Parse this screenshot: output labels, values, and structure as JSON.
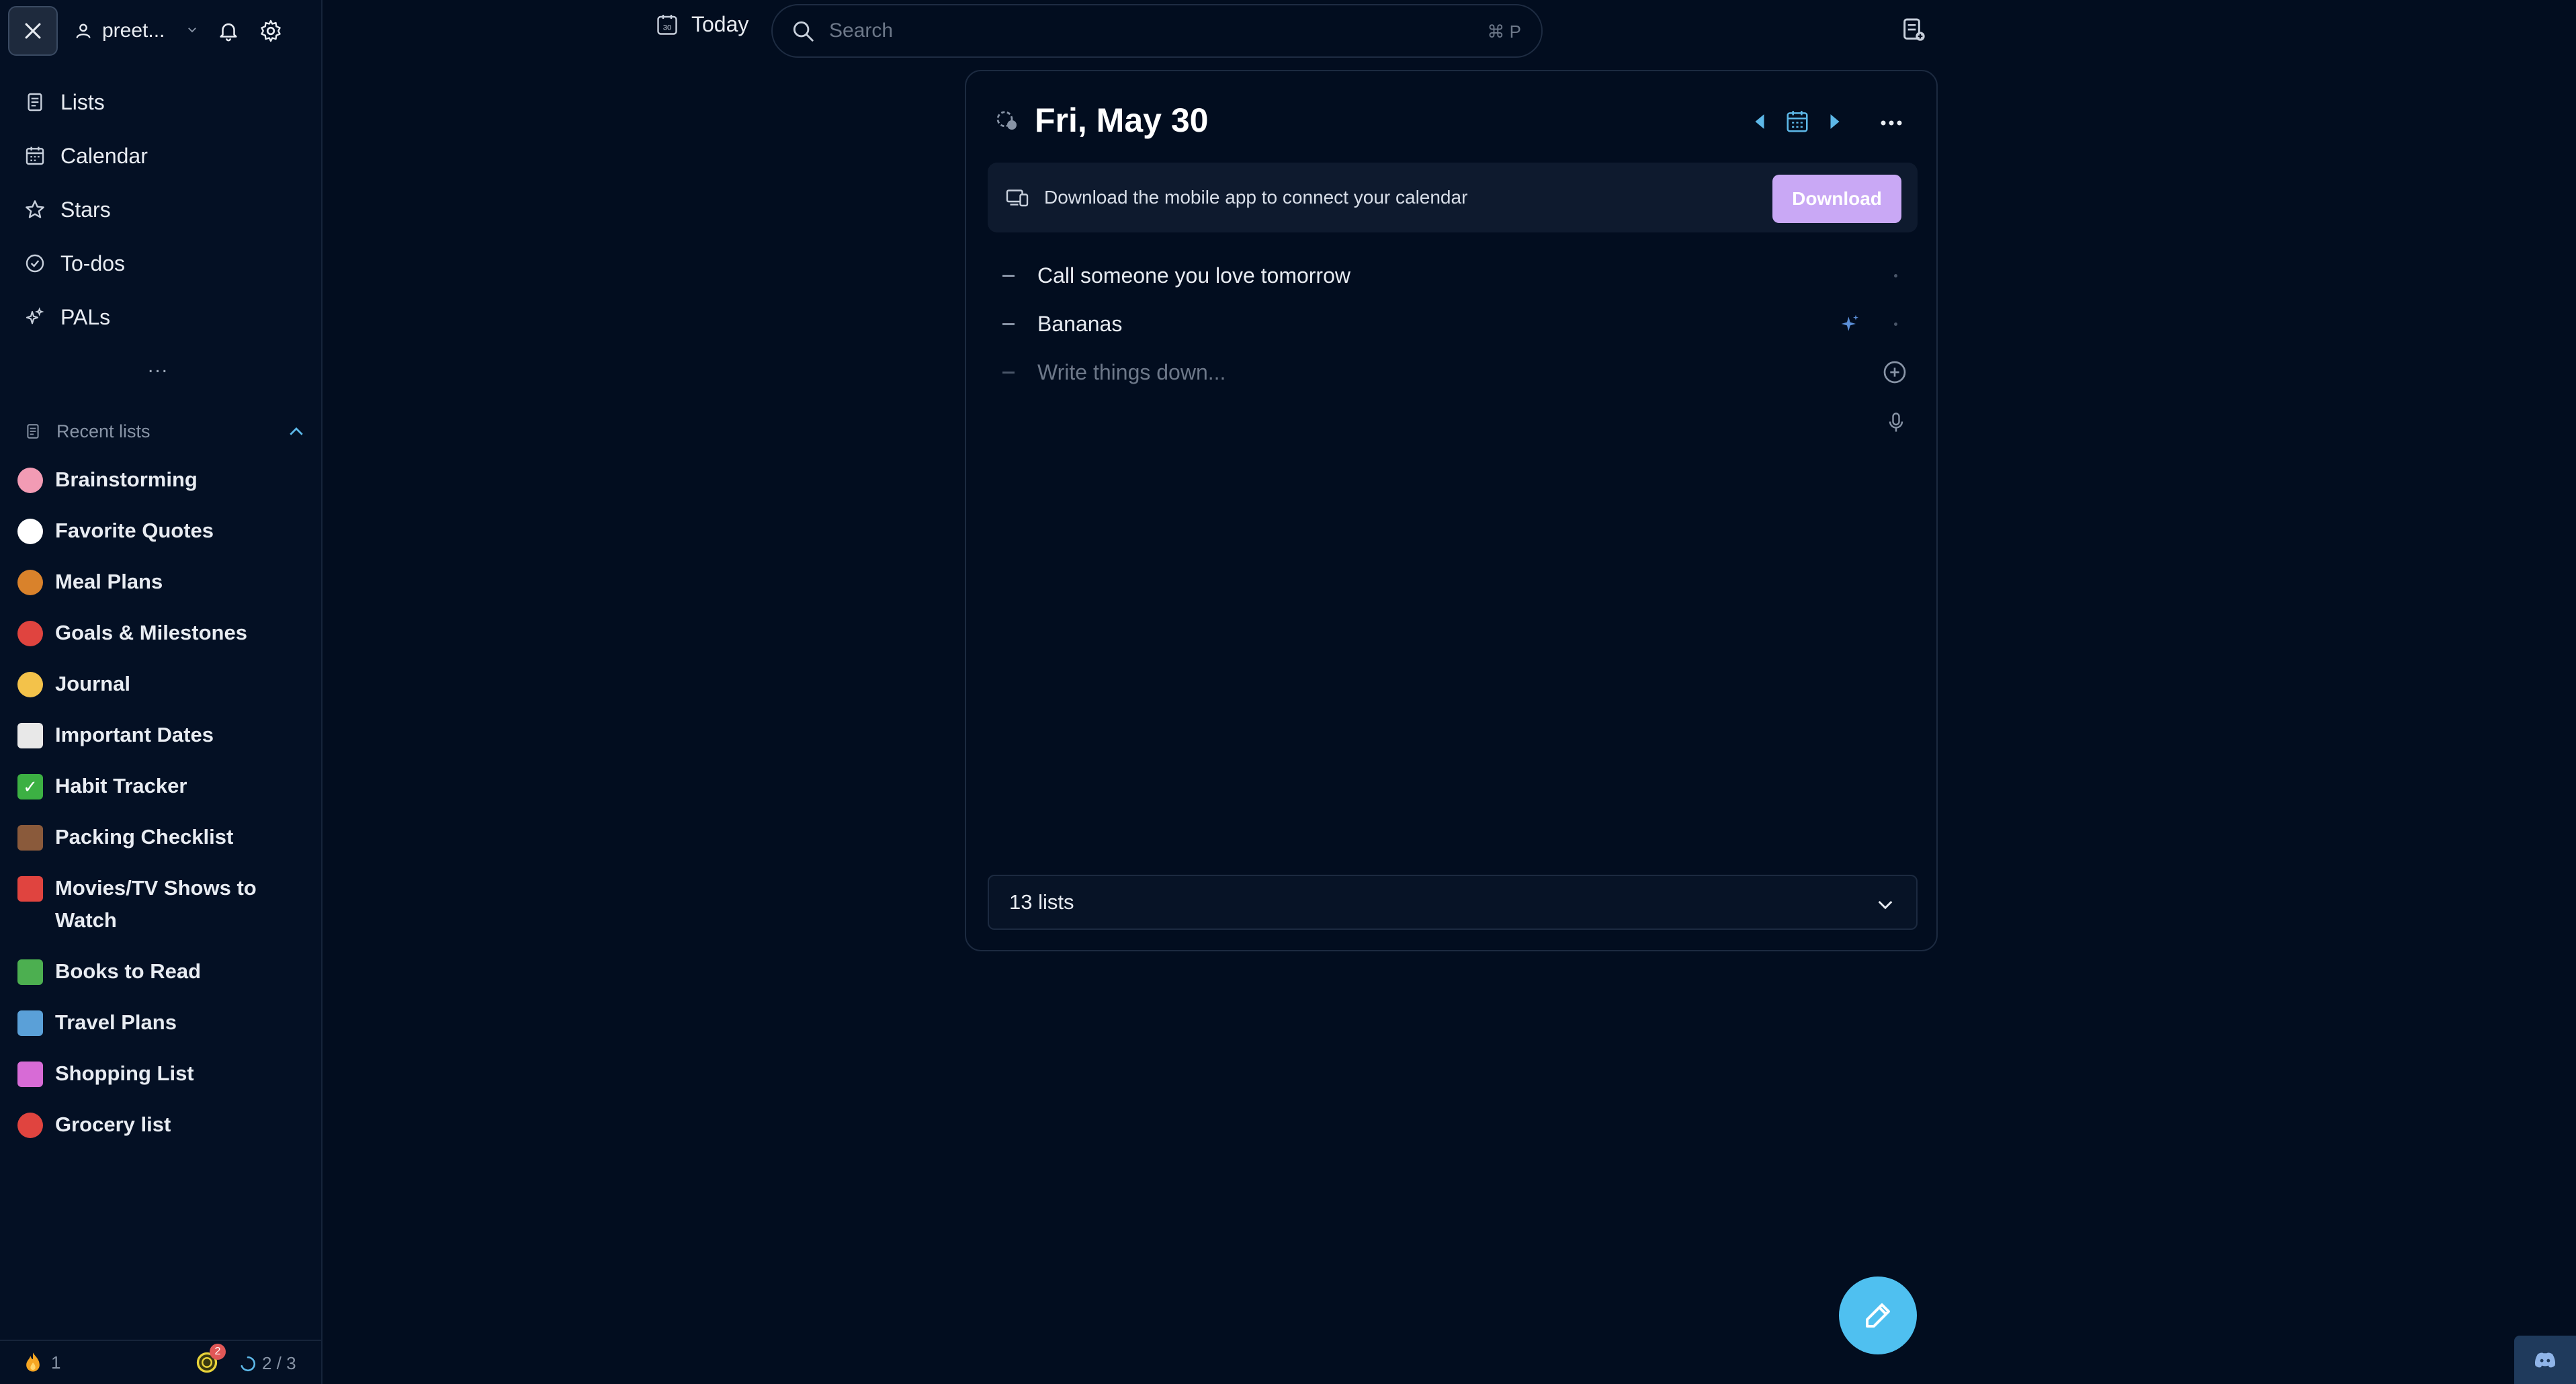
{
  "user": {
    "name": "preet..."
  },
  "nav": [
    {
      "label": "Lists",
      "icon": "list-icon"
    },
    {
      "label": "Calendar",
      "icon": "calendar-icon"
    },
    {
      "label": "Stars",
      "icon": "star-icon"
    },
    {
      "label": "To-dos",
      "icon": "check-circle-icon"
    },
    {
      "label": "PALs",
      "icon": "sparkles-icon"
    }
  ],
  "more_label": "...",
  "recent": {
    "title": "Recent lists",
    "items": [
      {
        "label": "Brainstorming",
        "emoji": "🧠",
        "color": "#f29bb4"
      },
      {
        "label": "Favorite Quotes",
        "emoji": "💭",
        "color": "#ffffff"
      },
      {
        "label": "Meal Plans",
        "emoji": "🥘",
        "color": "#d9822b"
      },
      {
        "label": "Goals & Milestones",
        "emoji": "🎯",
        "color": "#e0443f"
      },
      {
        "label": "Journal",
        "emoji": "✍️",
        "color": "#f3c24a"
      },
      {
        "label": "Important Dates",
        "emoji": "📅",
        "color": "#e8e8e8"
      },
      {
        "label": "Habit Tracker",
        "emoji": "✅",
        "color": "#3cb043"
      },
      {
        "label": "Packing Checklist",
        "emoji": "🧳",
        "color": "#8a5a3b"
      },
      {
        "label": "Movies/TV Shows to Watch",
        "emoji": "🍿",
        "color": "#e0443f"
      },
      {
        "label": "Books to Read",
        "emoji": "📚",
        "color": "#4caf50"
      },
      {
        "label": "Travel Plans",
        "emoji": "🗺️",
        "color": "#5aa0d8"
      },
      {
        "label": "Shopping List",
        "emoji": "🛍️",
        "color": "#d76bd6"
      },
      {
        "label": "Grocery list",
        "emoji": "🍎",
        "color": "#e0443f"
      }
    ]
  },
  "footer": {
    "streak": "1",
    "coin_badge": "2",
    "progress": "2 / 3"
  },
  "header": {
    "today_label": "Today",
    "today_icon_num": "30",
    "search_placeholder": "Search",
    "search_shortcut": "⌘ P"
  },
  "day": {
    "title": "Fri, May 30",
    "banner_text": "Download the mobile app to connect your calendar",
    "download_label": "Download",
    "items": [
      "Call someone you love tomorrow",
      "Bananas"
    ],
    "input_placeholder": "Write things down...",
    "lists_count": "13 lists"
  },
  "colors": {
    "accent": "#4fc0f0",
    "download": "#c9a8f5",
    "background": "#020d1f"
  }
}
